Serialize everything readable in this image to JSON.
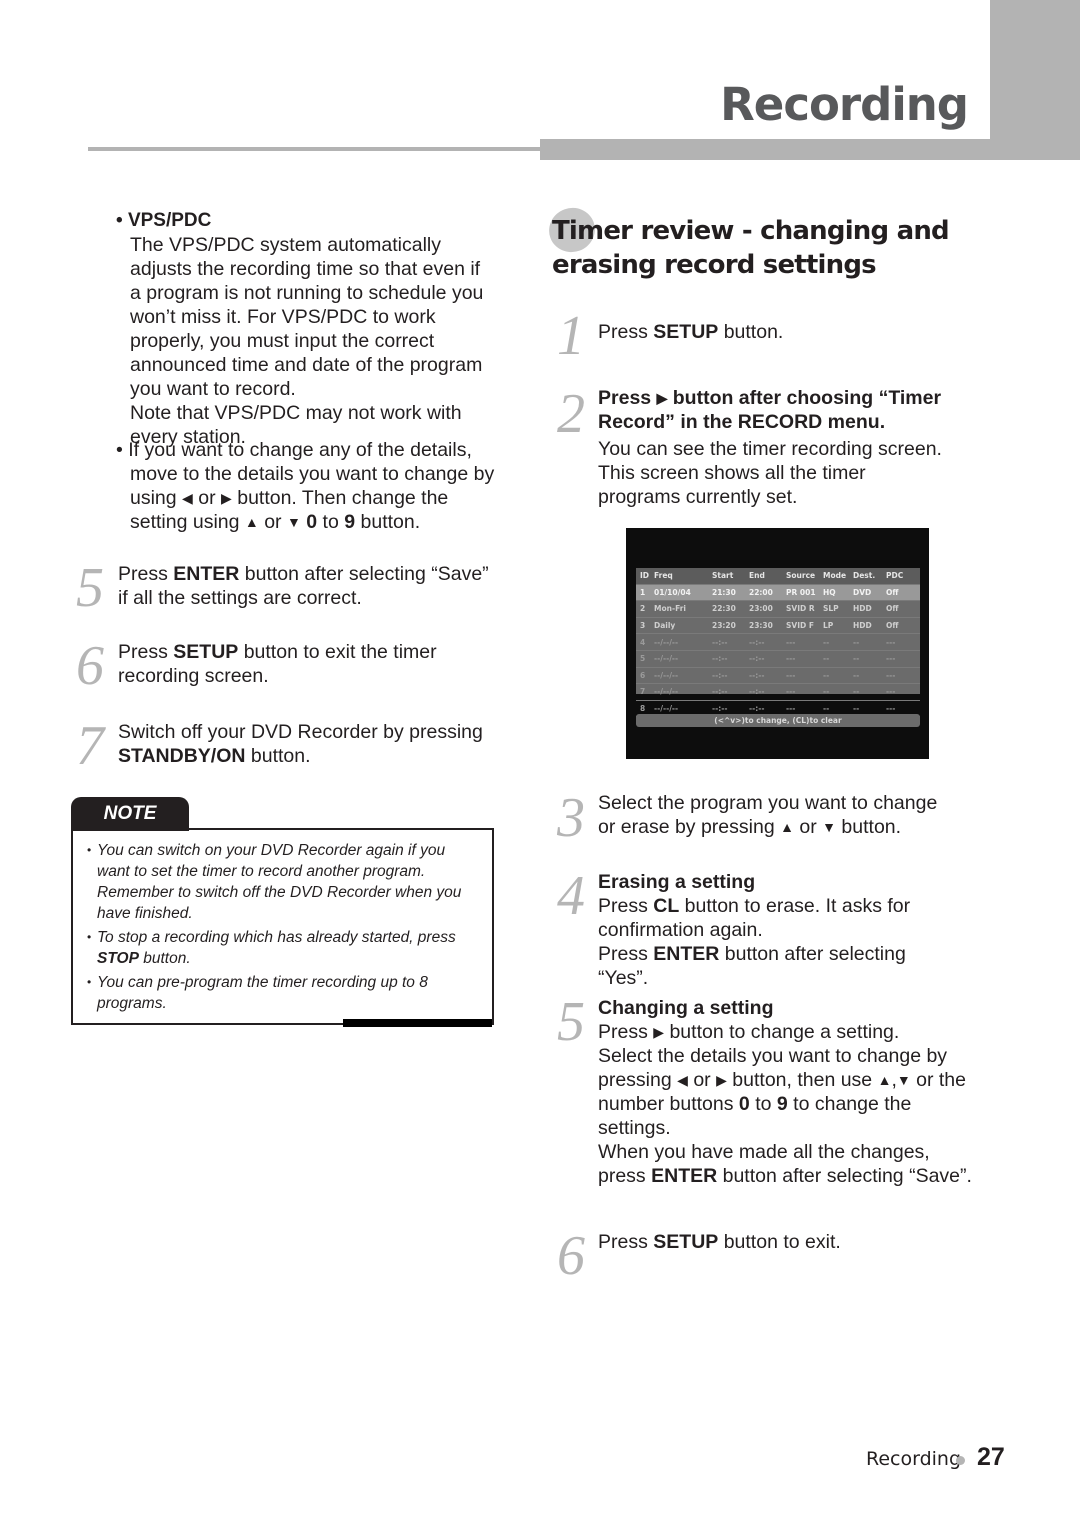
{
  "header": {
    "chapter_title": "Recording"
  },
  "left_column": {
    "bullets": [
      {
        "heading": "VPS/PDC",
        "paragraphs": [
          "The VPS/PDC system automatically adjusts the recording time so that even if a program is not running to schedule you won’t miss it. For VPS/PDC to work properly, you must input the correct announced time and date of the program you want to record.",
          "Note that VPS/PDC may not work with every station."
        ]
      },
      {
        "text_a": "If you want to change any of the details, move to the details you want to change by using",
        "icon_left": "◀",
        "or": "or",
        "icon_right": "▶",
        "text_b": "button. Then change the setting using",
        "icon_up": "▲",
        "icon_down": "▼",
        "num_0": "0",
        "to": "to",
        "num_9": "9",
        "text_c": "button."
      }
    ],
    "steps": [
      {
        "number": "5",
        "pre": "Press ",
        "bold": "ENTER",
        "post": " button after selecting “Save” if all the settings are correct."
      },
      {
        "number": "6",
        "pre": "Press ",
        "bold": "SETUP",
        "post": " button to exit the timer recording screen."
      },
      {
        "number": "7",
        "pre": "Switch off your DVD Recorder by pressing ",
        "bold": "STANDBY/ON",
        "post": " button."
      }
    ],
    "note": {
      "label": "NOTE",
      "items": [
        {
          "text": "You can switch on your DVD Recorder again if you want to set the timer to record another program. Remember to switch off the DVD Recorder when you have finished."
        },
        {
          "pre": "To stop a recording which has already started, press ",
          "bold": "STOP",
          "post": " button."
        },
        {
          "text": "You can pre-program the timer recording up to 8 programs."
        }
      ]
    }
  },
  "right_column": {
    "section_title_line1": "Timer review - changing and",
    "section_title_line2": "erasing record settings",
    "steps": [
      {
        "number": "1",
        "pre": "Press ",
        "bold": "SETUP",
        "post": " button."
      },
      {
        "number": "2",
        "heading_pre": "Press ",
        "heading_icon": "▶",
        "heading_post": " button after choosing “Timer Record” in the RECORD menu.",
        "body": "You can see the timer recording screen. This screen shows all the timer programs currently set."
      },
      {
        "number": "3",
        "pre": "Select the program you want to change or erase by pressing ",
        "icon_up": "▲",
        "or": " or ",
        "icon_down": "▼",
        "post": " button."
      },
      {
        "number": "4",
        "heading": "Erasing a setting",
        "line1_pre": "Press ",
        "line1_bold": "CL",
        "line1_post": " button to erase. It asks for confirmation again.",
        "line2_pre": "Press ",
        "line2_bold": "ENTER",
        "line2_post": " button after selecting “Yes”."
      },
      {
        "number": "5",
        "heading": "Changing a setting",
        "line1_pre": "Press ",
        "line1_icon": "▶",
        "line1_post": " button to change a setting.",
        "line2_a": "Select the details you want to change by pressing ",
        "icon_left": "◀",
        "or": " or ",
        "icon_right": "▶",
        "line2_b": " button, then use ",
        "icon_up": "▲",
        "comma": ",",
        "icon_down": "▼",
        "line2_c": " or the number buttons ",
        "num_0": "0",
        "to": " to ",
        "num_9": "9",
        "line2_d": " to change the settings.",
        "line3_a": "When you have made all the changes, press ",
        "line3_bold": "ENTER",
        "line3_b": " button after selecting “Save”."
      },
      {
        "number": "6",
        "pre": "Press ",
        "bold": "SETUP",
        "post": " button to exit."
      }
    ],
    "timer_screen": {
      "columns": [
        "ID",
        "Freq",
        "Start",
        "End",
        "Source",
        "Mode",
        "Dest.",
        "PDC"
      ],
      "rows": [
        [
          "1",
          "01/10/04",
          "21:30",
          "22:00",
          "PR 001",
          "HQ",
          "DVD",
          "Off"
        ],
        [
          "2",
          "Mon-Fri",
          "22:30",
          "23:00",
          "SVID R",
          "SLP",
          "HDD",
          "Off"
        ],
        [
          "3",
          "Daily",
          "23:20",
          "23:30",
          "SVID F",
          "LP",
          "HDD",
          "Off"
        ],
        [
          "4",
          "--/--/--",
          "--:--",
          "--:--",
          "---",
          "--",
          "--",
          "---"
        ],
        [
          "5",
          "--/--/--",
          "--:--",
          "--:--",
          "---",
          "--",
          "--",
          "---"
        ],
        [
          "6",
          "--/--/--",
          "--:--",
          "--:--",
          "---",
          "--",
          "--",
          "---"
        ],
        [
          "7",
          "--/--/--",
          "--:--",
          "--:--",
          "---",
          "--",
          "--",
          "---"
        ],
        [
          "8",
          "--/--/--",
          "--:--",
          "--:--",
          "---",
          "--",
          "--",
          "---"
        ]
      ],
      "hint": "(<^v>)to change, (CL)to clear"
    }
  },
  "footer": {
    "section": "Recording",
    "page_number": "27"
  }
}
